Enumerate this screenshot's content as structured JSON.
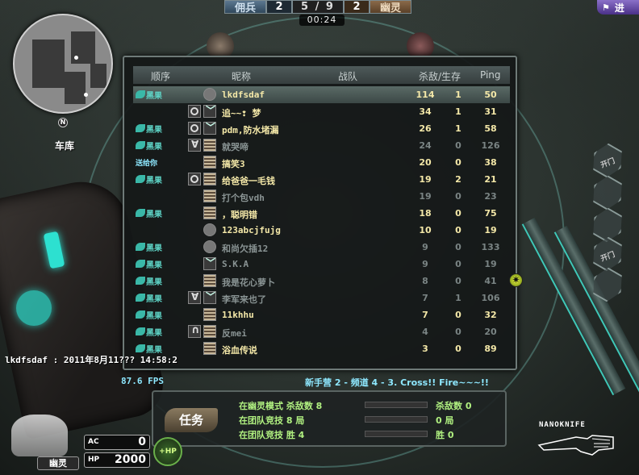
{
  "top": {
    "team_merc": "佣兵",
    "merc_score": "2",
    "round": "5 / 9",
    "ghost_score": "2",
    "team_ghost": "幽灵",
    "timer": "00:24",
    "corner_badge": "进"
  },
  "minimap": {
    "map_name": "车库",
    "north": "N"
  },
  "board": {
    "headers": {
      "rank": "顺序",
      "name": "昵称",
      "clan": "战队",
      "kd": "杀敌/生存",
      "ping": "Ping"
    },
    "rows": [
      {
        "rank": "黑果",
        "name": "lkdfsdaf",
        "kills": "114",
        "alive": "1",
        "ping": "50",
        "me": true,
        "dead": false
      },
      {
        "rank": "",
        "name": "追~~❢ 梦",
        "kills": "34",
        "alive": "1",
        "ping": "31",
        "dead": false
      },
      {
        "rank": "黑果",
        "name": "pdm,防水堵漏",
        "kills": "26",
        "alive": "1",
        "ping": "58",
        "dead": false
      },
      {
        "rank": "黑果",
        "name": "就哭啼",
        "kills": "24",
        "alive": "0",
        "ping": "126",
        "dead": true
      },
      {
        "rank": "送给你",
        "name": "搞笑3",
        "kills": "20",
        "alive": "0",
        "ping": "38",
        "dead": false
      },
      {
        "rank": "黑果",
        "name": "给爸爸一毛钱",
        "kills": "19",
        "alive": "2",
        "ping": "21",
        "dead": false
      },
      {
        "rank": "",
        "name": "打个包vdh",
        "kills": "19",
        "alive": "0",
        "ping": "23",
        "dead": true
      },
      {
        "rank": "黑果",
        "name": "，聪明错",
        "kills": "18",
        "alive": "0",
        "ping": "75",
        "dead": false
      },
      {
        "rank": "",
        "name": "123abcjfujg",
        "kills": "10",
        "alive": "0",
        "ping": "19",
        "dead": false
      },
      {
        "rank": "黑果",
        "name": "和尚欠插12",
        "kills": "9",
        "alive": "0",
        "ping": "133",
        "dead": true
      },
      {
        "rank": "黑果",
        "name": "S.K.A",
        "kills": "9",
        "alive": "0",
        "ping": "19",
        "dead": true
      },
      {
        "rank": "黑果",
        "name": "我是花心萝卜",
        "kills": "8",
        "alive": "0",
        "ping": "41",
        "dead": true
      },
      {
        "rank": "黑果",
        "name": "李军来也了",
        "kills": "7",
        "alive": "1",
        "ping": "106",
        "dead": true
      },
      {
        "rank": "黑果",
        "name": "11khhu",
        "kills": "7",
        "alive": "0",
        "ping": "32",
        "dead": false
      },
      {
        "rank": "黑果",
        "name": "反mei",
        "kills": "4",
        "alive": "0",
        "ping": "20",
        "dead": true
      },
      {
        "rank": "黑果",
        "name": "浴血传说",
        "kills": "3",
        "alive": "0",
        "ping": "89",
        "dead": false
      }
    ]
  },
  "chat": "lkdfsdaf : 2011年8月11??? 14:58:2",
  "fps": "87.6 FPS",
  "channel": "新手营 2 - 频道 4 - 3. Cross!! Fire~~~!!",
  "mission": {
    "tag": "任务",
    "items": [
      {
        "label": "在幽灵模式 杀敌数 8",
        "value": "杀敌数 0"
      },
      {
        "label": "在团队竞技 8 局",
        "value": "0 局"
      },
      {
        "label": "在团队竞技 胜 4",
        "value": "胜 0"
      }
    ]
  },
  "hud": {
    "ac_label": "AC",
    "ac_value": "0",
    "hp_label": "HP",
    "hp_value": "2000",
    "hp_badge": "+HP",
    "role": "幽灵",
    "weapon": "NANOKNIFE"
  },
  "side_buttons": [
    "开门",
    "开门"
  ],
  "colors": {
    "accent": "#5fd6c8",
    "alive_text": "#f4e8a8",
    "dead_text": "#8a9494",
    "mission_text": "#b0f080"
  }
}
